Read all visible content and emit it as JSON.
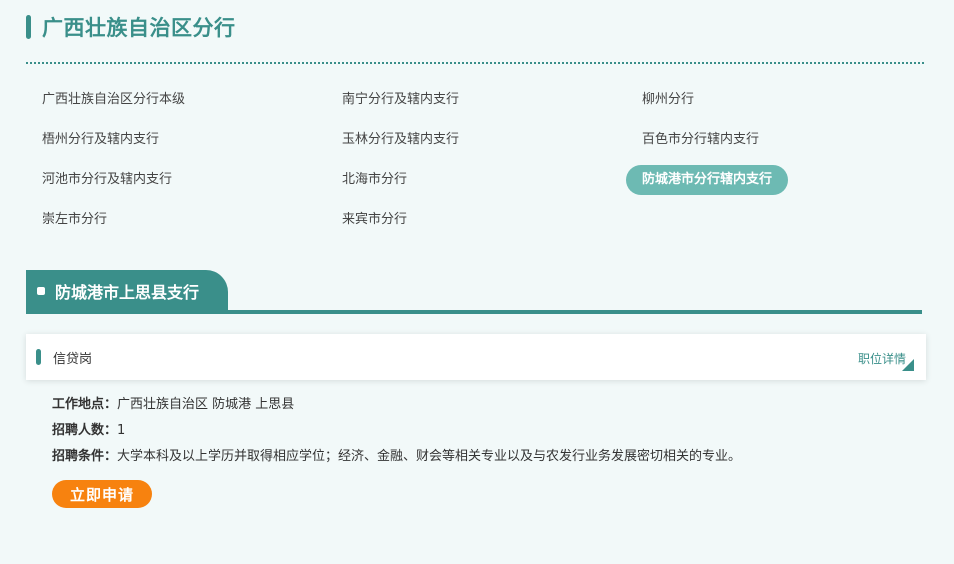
{
  "region": {
    "title": "广西壮族自治区分行"
  },
  "branches": [
    {
      "label": "广西壮族自治区分行本级",
      "active": false
    },
    {
      "label": "南宁分行及辖内支行",
      "active": false
    },
    {
      "label": "柳州分行",
      "active": false
    },
    {
      "label": "梧州分行及辖内支行",
      "active": false
    },
    {
      "label": "玉林分行及辖内支行",
      "active": false
    },
    {
      "label": "百色市分行辖内支行",
      "active": false
    },
    {
      "label": "河池市分行及辖内支行",
      "active": false
    },
    {
      "label": "北海市分行",
      "active": false
    },
    {
      "label": "防城港市分行辖内支行",
      "active": true
    },
    {
      "label": "崇左市分行",
      "active": false
    },
    {
      "label": "来宾市分行",
      "active": false
    }
  ],
  "sub_branch": {
    "title": "防城港市上思县支行"
  },
  "job": {
    "title": "信贷岗",
    "detail_link": "职位详情",
    "location_label": "工作地点：",
    "location_value": "广西壮族自治区 防城港 上思县",
    "headcount_label": "招聘人数：",
    "headcount_value": "1",
    "requirements_label": "招聘条件：",
    "requirements_value": "大学本科及以上学历并取得相应学位；经济、金融、财会等相关专业以及与农发行业务发展密切相关的专业。",
    "apply_label": "立即申请"
  },
  "colors": {
    "accent": "#3a8f8a",
    "active_pill": "#6dbab3",
    "apply_button": "#f7820f",
    "background": "#f2f9f9"
  }
}
